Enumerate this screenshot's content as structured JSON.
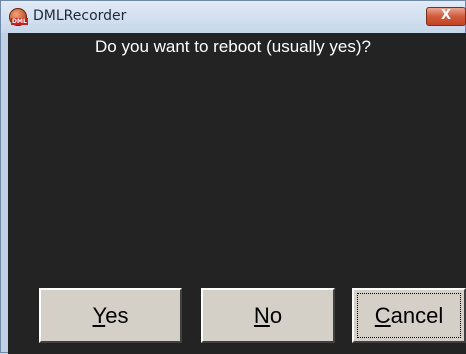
{
  "window": {
    "title": "DMLRecorder",
    "icon": "dml-recorder-icon",
    "icon_badge": "DML"
  },
  "titlebar": {
    "close_glyph": "X"
  },
  "dialog": {
    "message": "Do you want to reboot (usually yes)?"
  },
  "buttons": {
    "yes": {
      "mnemonic": "Y",
      "rest": "es"
    },
    "no": {
      "mnemonic": "N",
      "rest": "o"
    },
    "cancel": {
      "mnemonic": "C",
      "rest": "ancel"
    }
  },
  "colors": {
    "background": "#232323",
    "text": "#ffffff",
    "button_face": "#d4d0c8",
    "close": "#c24424"
  }
}
